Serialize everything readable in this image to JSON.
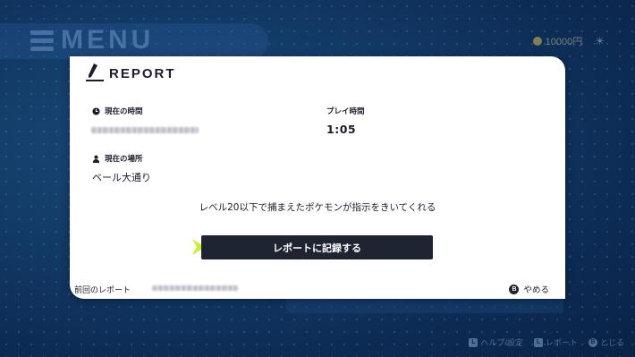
{
  "background": {
    "menu_title": "MENU",
    "money": "10000円",
    "hints": [
      {
        "key": "L",
        "label": "ヘルプ/設定"
      },
      {
        "key": "L",
        "label": "レポート"
      },
      {
        "key": "B",
        "label": "とじる"
      }
    ]
  },
  "report": {
    "title": "REPORT",
    "current_time_label": "現在の時間",
    "play_time_label": "プレイ時間",
    "play_time_value": "1:05",
    "location_label": "現在の場所",
    "location_value": "ベール大通り",
    "message": "レベル20以下で捕まえたポケモンが指示をきいてくれる",
    "record_button_label": "レポートに記録する",
    "previous_report_label": "前回のレポート",
    "cancel_key": "B",
    "cancel_label": "やめる"
  },
  "colors": {
    "card": "#ffffff",
    "button": "#1f2433",
    "cursor": "#c6f02a",
    "background": "#123a66"
  }
}
